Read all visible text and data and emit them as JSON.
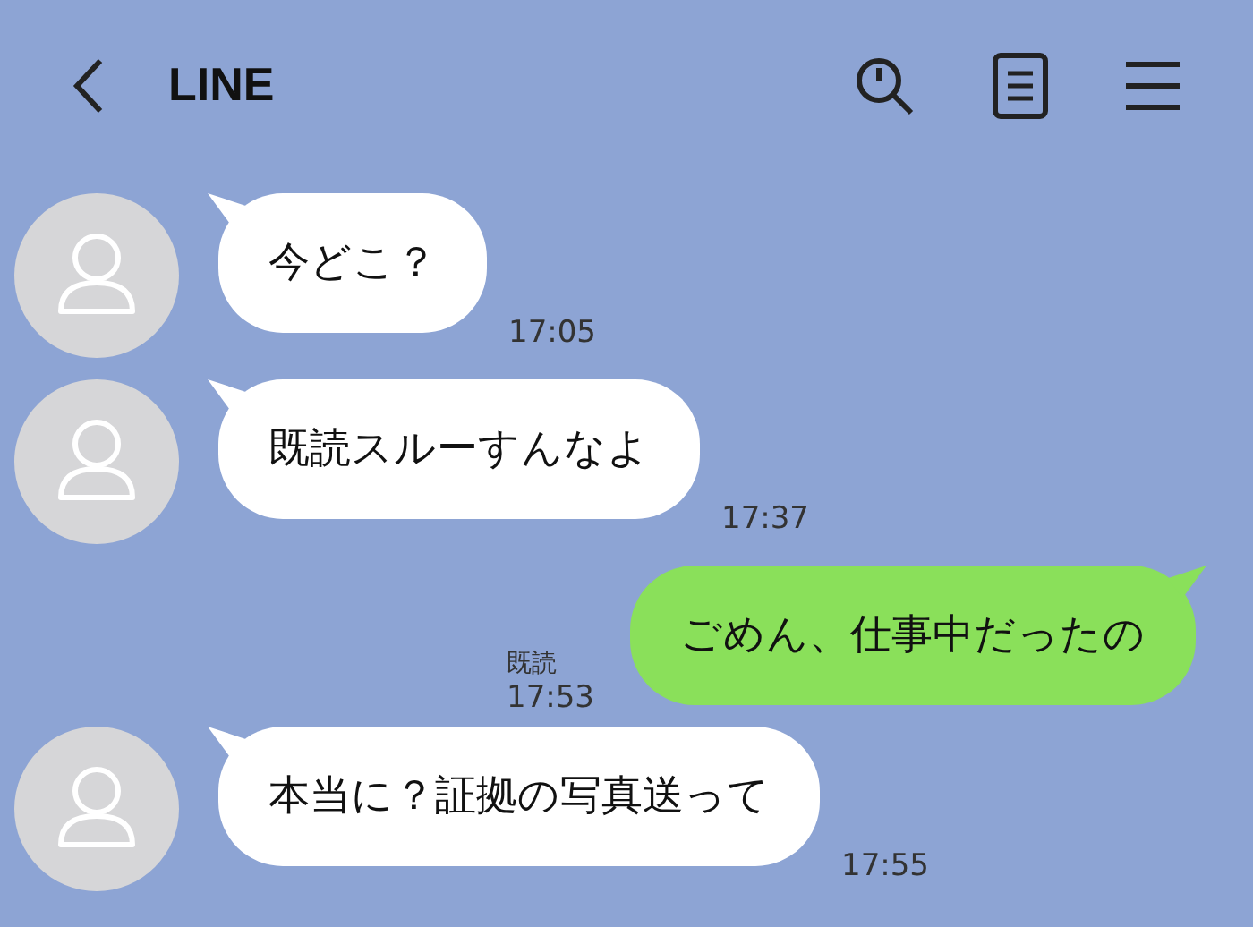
{
  "header": {
    "title": "LINE"
  },
  "messages": [
    {
      "kind": "incoming",
      "text": "今どこ？",
      "time": "17:05"
    },
    {
      "kind": "incoming",
      "text": "既読スルーすんなよ",
      "time": "17:37"
    },
    {
      "kind": "outgoing",
      "text": "ごめん、仕事中だったの",
      "read": "既読",
      "time": "17:53"
    },
    {
      "kind": "incoming",
      "text": "本当に？証拠の写真送って",
      "time": "17:55"
    }
  ]
}
